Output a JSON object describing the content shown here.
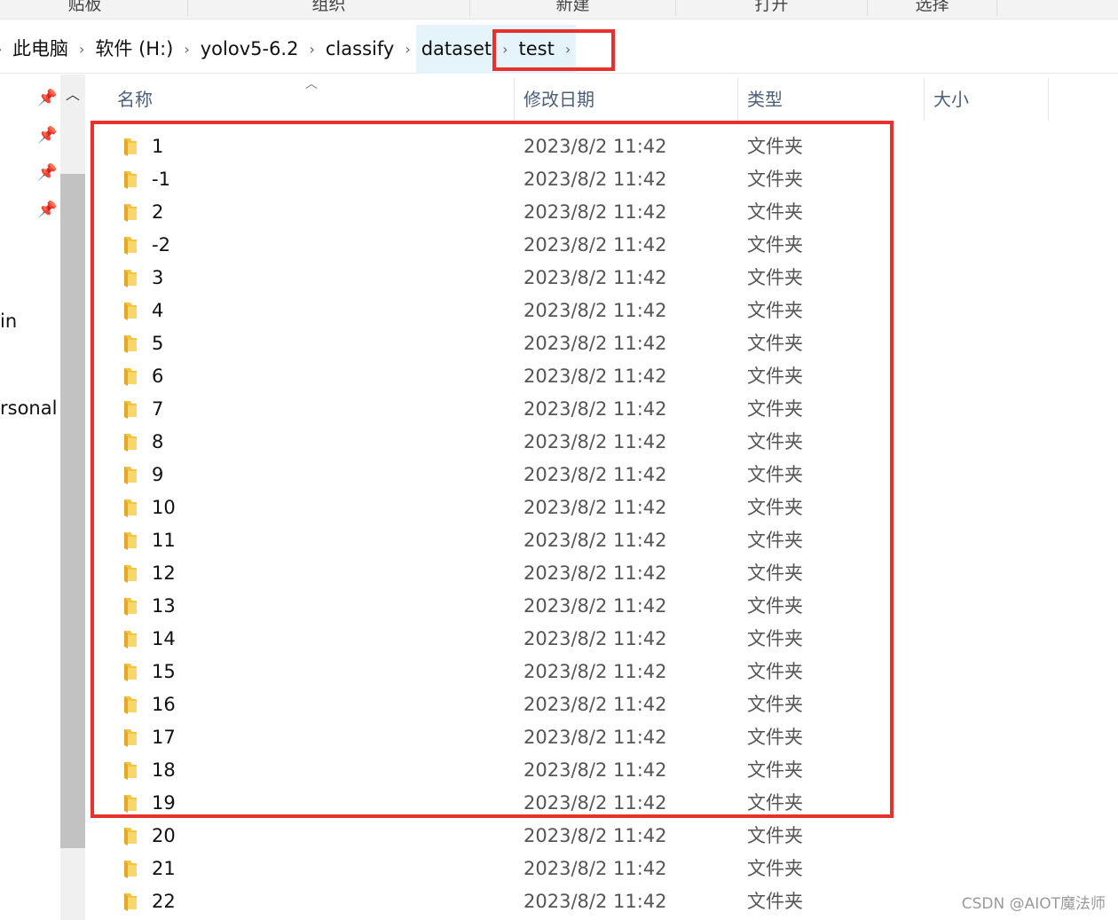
{
  "ribbon": {
    "groups": [
      "剪贴板",
      "组织",
      "新建",
      "打开",
      "选择"
    ],
    "visible": [
      "贴板",
      "组织",
      "新建",
      "打开",
      "选择"
    ]
  },
  "address": {
    "crumbs": [
      "此电脑",
      "软件 (H:)",
      "yolov5-6.2",
      "classify",
      "dataset",
      "test"
    ]
  },
  "nav": {
    "partial_labels": [
      "in",
      "rsonal"
    ],
    "pin_icon": "pin-icon"
  },
  "columns": {
    "name": "名称",
    "date": "修改日期",
    "type": "类型",
    "size": "大小"
  },
  "files": [
    {
      "name": "1",
      "date": "2023/8/2 11:42",
      "type": "文件夹"
    },
    {
      "name": "-1",
      "date": "2023/8/2 11:42",
      "type": "文件夹"
    },
    {
      "name": "2",
      "date": "2023/8/2 11:42",
      "type": "文件夹"
    },
    {
      "name": "-2",
      "date": "2023/8/2 11:42",
      "type": "文件夹"
    },
    {
      "name": "3",
      "date": "2023/8/2 11:42",
      "type": "文件夹"
    },
    {
      "name": "4",
      "date": "2023/8/2 11:42",
      "type": "文件夹"
    },
    {
      "name": "5",
      "date": "2023/8/2 11:42",
      "type": "文件夹"
    },
    {
      "name": "6",
      "date": "2023/8/2 11:42",
      "type": "文件夹"
    },
    {
      "name": "7",
      "date": "2023/8/2 11:42",
      "type": "文件夹"
    },
    {
      "name": "8",
      "date": "2023/8/2 11:42",
      "type": "文件夹"
    },
    {
      "name": "9",
      "date": "2023/8/2 11:42",
      "type": "文件夹"
    },
    {
      "name": "10",
      "date": "2023/8/2 11:42",
      "type": "文件夹"
    },
    {
      "name": "11",
      "date": "2023/8/2 11:42",
      "type": "文件夹"
    },
    {
      "name": "12",
      "date": "2023/8/2 11:42",
      "type": "文件夹"
    },
    {
      "name": "13",
      "date": "2023/8/2 11:42",
      "type": "文件夹"
    },
    {
      "name": "14",
      "date": "2023/8/2 11:42",
      "type": "文件夹"
    },
    {
      "name": "15",
      "date": "2023/8/2 11:42",
      "type": "文件夹"
    },
    {
      "name": "16",
      "date": "2023/8/2 11:42",
      "type": "文件夹"
    },
    {
      "name": "17",
      "date": "2023/8/2 11:42",
      "type": "文件夹"
    },
    {
      "name": "18",
      "date": "2023/8/2 11:42",
      "type": "文件夹"
    },
    {
      "name": "19",
      "date": "2023/8/2 11:42",
      "type": "文件夹"
    },
    {
      "name": "20",
      "date": "2023/8/2 11:42",
      "type": "文件夹"
    },
    {
      "name": "21",
      "date": "2023/8/2 11:42",
      "type": "文件夹"
    },
    {
      "name": "22",
      "date": "2023/8/2 11:42",
      "type": "文件夹"
    }
  ],
  "colors": {
    "annotation_red": "#e8302d",
    "folder_yellow": "#f4c542",
    "header_text": "#4c607a",
    "crumb_highlight": "#e5f3fb"
  },
  "watermark": "CSDN @AIOT魔法师"
}
